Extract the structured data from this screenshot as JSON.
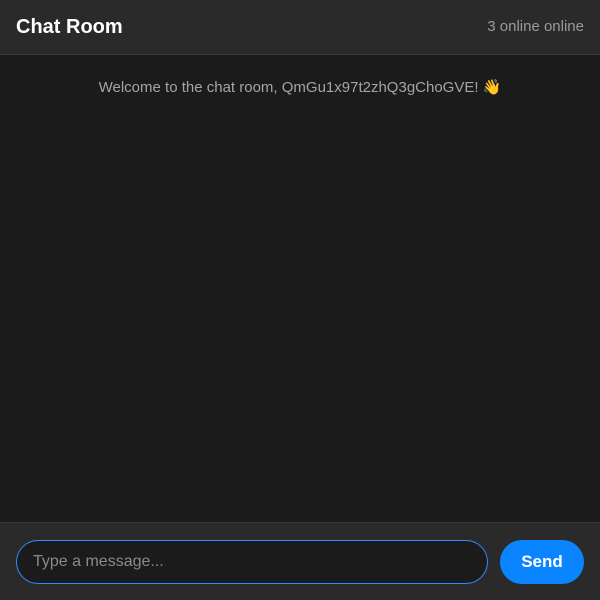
{
  "header": {
    "title": "Chat Room",
    "online_status": "3 online online"
  },
  "messages": {
    "system_welcome": "Welcome to the chat room, QmGu1x97t2zhQ3gChoGVE! 👋"
  },
  "composer": {
    "input_value": "",
    "input_placeholder": "Type a message...",
    "send_label": "Send"
  },
  "colors": {
    "background": "#1b1b1b",
    "panel": "#2a2a2a",
    "accent": "#0a84ff",
    "input_border": "#2f8cff",
    "muted_text": "#9a9a9a"
  }
}
